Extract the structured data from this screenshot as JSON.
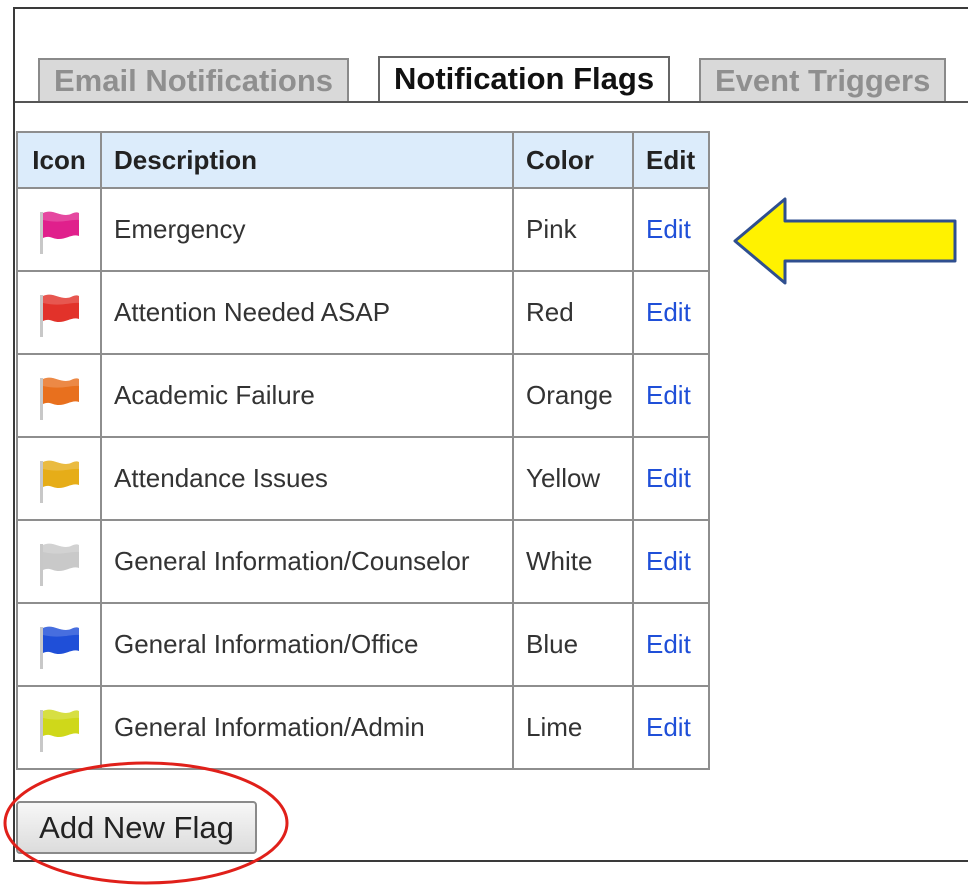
{
  "tabs": [
    {
      "label": "Email Notifications",
      "active": false
    },
    {
      "label": "Notification Flags",
      "active": true
    },
    {
      "label": "Event Triggers",
      "active": false
    }
  ],
  "table": {
    "headers": {
      "icon": "Icon",
      "description": "Description",
      "color": "Color",
      "edit": "Edit"
    },
    "rows": [
      {
        "description": "Emergency",
        "color": "Pink",
        "edit": "Edit",
        "flag_color": "#e0208c"
      },
      {
        "description": "Attention Needed ASAP",
        "color": "Red",
        "edit": "Edit",
        "flag_color": "#e2322a"
      },
      {
        "description": "Academic Failure",
        "color": "Orange",
        "edit": "Edit",
        "flag_color": "#e8701e"
      },
      {
        "description": "Attendance Issues",
        "color": "Yellow",
        "edit": "Edit",
        "flag_color": "#e6ad18"
      },
      {
        "description": "General Information/Counselor",
        "color": "White",
        "edit": "Edit",
        "flag_color": "#c9c9c9"
      },
      {
        "description": "General Information/Office",
        "color": "Blue",
        "edit": "Edit",
        "flag_color": "#1f4fd8"
      },
      {
        "description": "General Information/Admin",
        "color": "Lime",
        "edit": "Edit",
        "flag_color": "#cfd81a"
      }
    ]
  },
  "add_button": {
    "label": "Add New Flag"
  },
  "annotations": {
    "arrow_color": "#fff200",
    "circle_color": "#e0201a"
  }
}
